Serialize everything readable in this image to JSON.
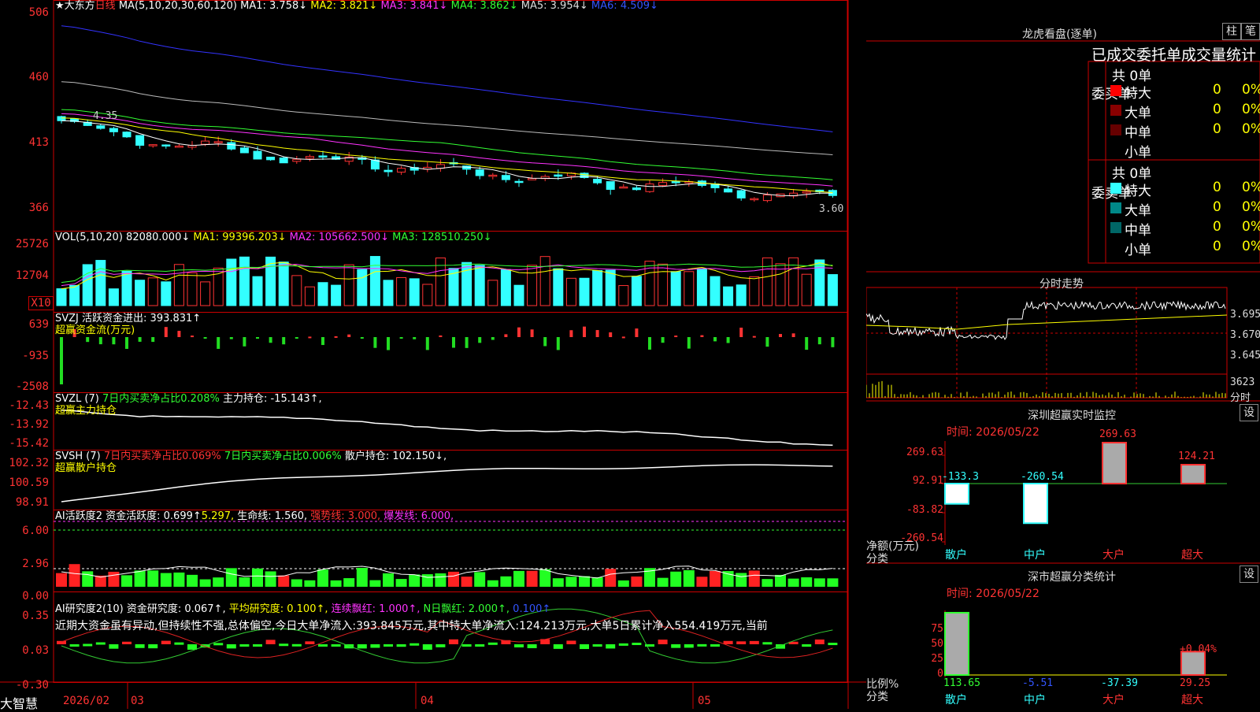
{
  "colors": {
    "up": "#ff3333",
    "down": "#33ffff",
    "ma1": "#ffffff",
    "ma2": "#ffff00",
    "ma3": "#ff33ff",
    "ma4": "#33ff33",
    "ma5": "#bbbbbb",
    "ma6": "#3333ff",
    "frame": "#cc0000"
  },
  "header": {
    "star": "★",
    "stock": "大东方",
    "period": "日线",
    "ma_def": "MA(5,10,20,30,60,120)",
    "ma1": "MA1: 3.758↓",
    "ma2": "MA2: 3.821↓",
    "ma3": "MA3: 3.841↓",
    "ma4": "MA4: 3.862↓",
    "ma5": "MA5: 3.954↓",
    "ma6": "MA6: 4.509↓"
  },
  "price_axis": [
    "506",
    "460",
    "413",
    "366"
  ],
  "price_high_label": "4.35",
  "price_low_label": "3.60",
  "vol": {
    "title": "VOL(5,10,20)",
    "val": "82080.000↓",
    "ma1": "MA1: 99396.203↓",
    "ma2": "MA2: 105662.500↓",
    "ma3": "MA3: 128510.250↓",
    "axis": [
      "25726",
      "12704"
    ],
    "unit": "X10"
  },
  "svzj": {
    "title": "SVZJ",
    "t1": "活跃资金进出: 393.831↑",
    "t2": "超赢资金流(万元)",
    "axis": [
      "639",
      "-935",
      "-2508"
    ]
  },
  "svzl": {
    "title": "SVZL (7)",
    "t1": "7日内买卖净占比0.208%",
    "t2": "主力持仓: -15.143↑,",
    "t3": "超赢主力持仓",
    "axis": [
      "-12.43",
      "-13.92",
      "-15.42"
    ]
  },
  "svsh": {
    "title": "SVSH (7)",
    "t1": "7日内买卖净占比0.069%",
    "t2": "7日内买卖净占比0.006%",
    "t3": "散户持仓: 102.150↓,",
    "t4": "超赢散户持仓",
    "axis": [
      "102.32",
      "100.59",
      "98.91"
    ]
  },
  "ai2": {
    "title": "AI活跃度2",
    "t1": "资金活跃度: 0.699↑",
    "t2": "5.297,",
    "t3": "生命线: 1.560,",
    "t4": "强势线: 3.000,",
    "t5": "爆发线: 6.000,",
    "axis": [
      "6.00",
      "2.96",
      "0.00"
    ]
  },
  "ai_r": {
    "title": "AI研究度2(10)",
    "t1": "资金研究度: 0.067↑,",
    "t2": "平均研究度: 0.100↑,",
    "t3": "连续飘红: 1.000↑,",
    "t4": "N日飘红: 2.000↑,",
    "t5": "0.100↑",
    "note": "近期大资金虽有异动,但持续性不强,总体偏空,今日大单净流入:393.845万元,其中特大单净流入:124.213万元,大单5日累计净入554.419万元,当前",
    "axis": [
      "0.35",
      "0.03",
      "-0.30"
    ]
  },
  "dates": [
    "2026/02",
    "03",
    "04",
    "05"
  ],
  "brand": "大智慧",
  "dragon": {
    "title": "龙虎看盘(逐单)",
    "btn1": "柱",
    "btn2": "笔",
    "sub": "已成交委托单成交量统计",
    "buy": {
      "label": "委买单",
      "total": "共 0单",
      "rows": [
        [
          "特大",
          "0",
          "0%"
        ],
        [
          "大单",
          "0",
          "0%"
        ],
        [
          "中单",
          "0",
          "0%"
        ],
        [
          "小单",
          "",
          ""
        ]
      ]
    },
    "sell": {
      "label": "委卖单",
      "total": "共 0单",
      "rows": [
        [
          "特大",
          "0",
          "0%"
        ],
        [
          "大单",
          "0",
          "0%"
        ],
        [
          "中单",
          "0",
          "0%"
        ],
        [
          "小单",
          "0",
          "0%"
        ]
      ]
    }
  },
  "intraday": {
    "title": "分时走势",
    "axis": [
      "3.695",
      "3.670",
      "3.645"
    ],
    "vol_max": "3623",
    "vol_unit": "分时"
  },
  "monitor": {
    "title": "深圳超赢实时监控",
    "btn": "设",
    "time": "时间: 2026/05/22",
    "axis": [
      "269.63",
      "92.91",
      "-83.82",
      "-260.54"
    ],
    "ylab": "净额(万元)",
    "xlab": "分类",
    "cats": [
      "散户",
      "中户",
      "大户",
      "超大"
    ],
    "values": [
      -133.3,
      -260.54,
      269.63,
      124.21
    ],
    "value_labels": [
      "-133.3",
      "-260.54",
      "269.63",
      "124.21"
    ]
  },
  "classify": {
    "title": "深市超赢分类统计",
    "btn": "设",
    "time": "时间: 2026/05/22",
    "axis": [
      "75",
      "50",
      "25",
      "0"
    ],
    "ylab": "比例%",
    "xlab": "分类",
    "cats": [
      "散户",
      "中户",
      "大户",
      "超大"
    ],
    "values": [
      113.65,
      -5.51,
      -37.39,
      29.25
    ],
    "value_labels": [
      "113.65",
      "-5.51",
      "-37.39",
      "29.25"
    ],
    "extra": "+0.04%"
  }
}
